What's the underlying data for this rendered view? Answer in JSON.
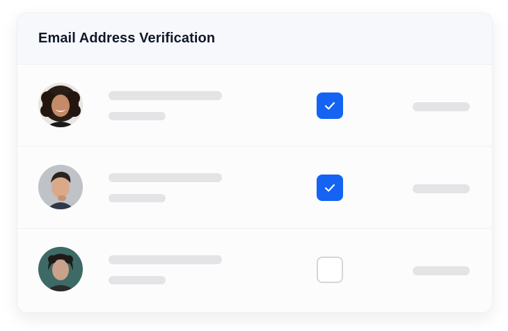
{
  "card": {
    "title": "Email Address Verification"
  },
  "rows": [
    {
      "avatar_icon": "avatar-woman-curly-hair",
      "verified": true,
      "check_icon": "checkmark-icon"
    },
    {
      "avatar_icon": "avatar-man-dark-hair",
      "verified": true,
      "check_icon": "checkmark-icon"
    },
    {
      "avatar_icon": "avatar-person-dark-hair",
      "verified": false,
      "check_icon": "checkmark-icon"
    }
  ],
  "colors": {
    "accent": "#1463f3",
    "skeleton": "#e4e4e7",
    "header_bg": "#f6f8fc",
    "title_text": "#111827",
    "unchecked_border": "#d4d6da"
  }
}
